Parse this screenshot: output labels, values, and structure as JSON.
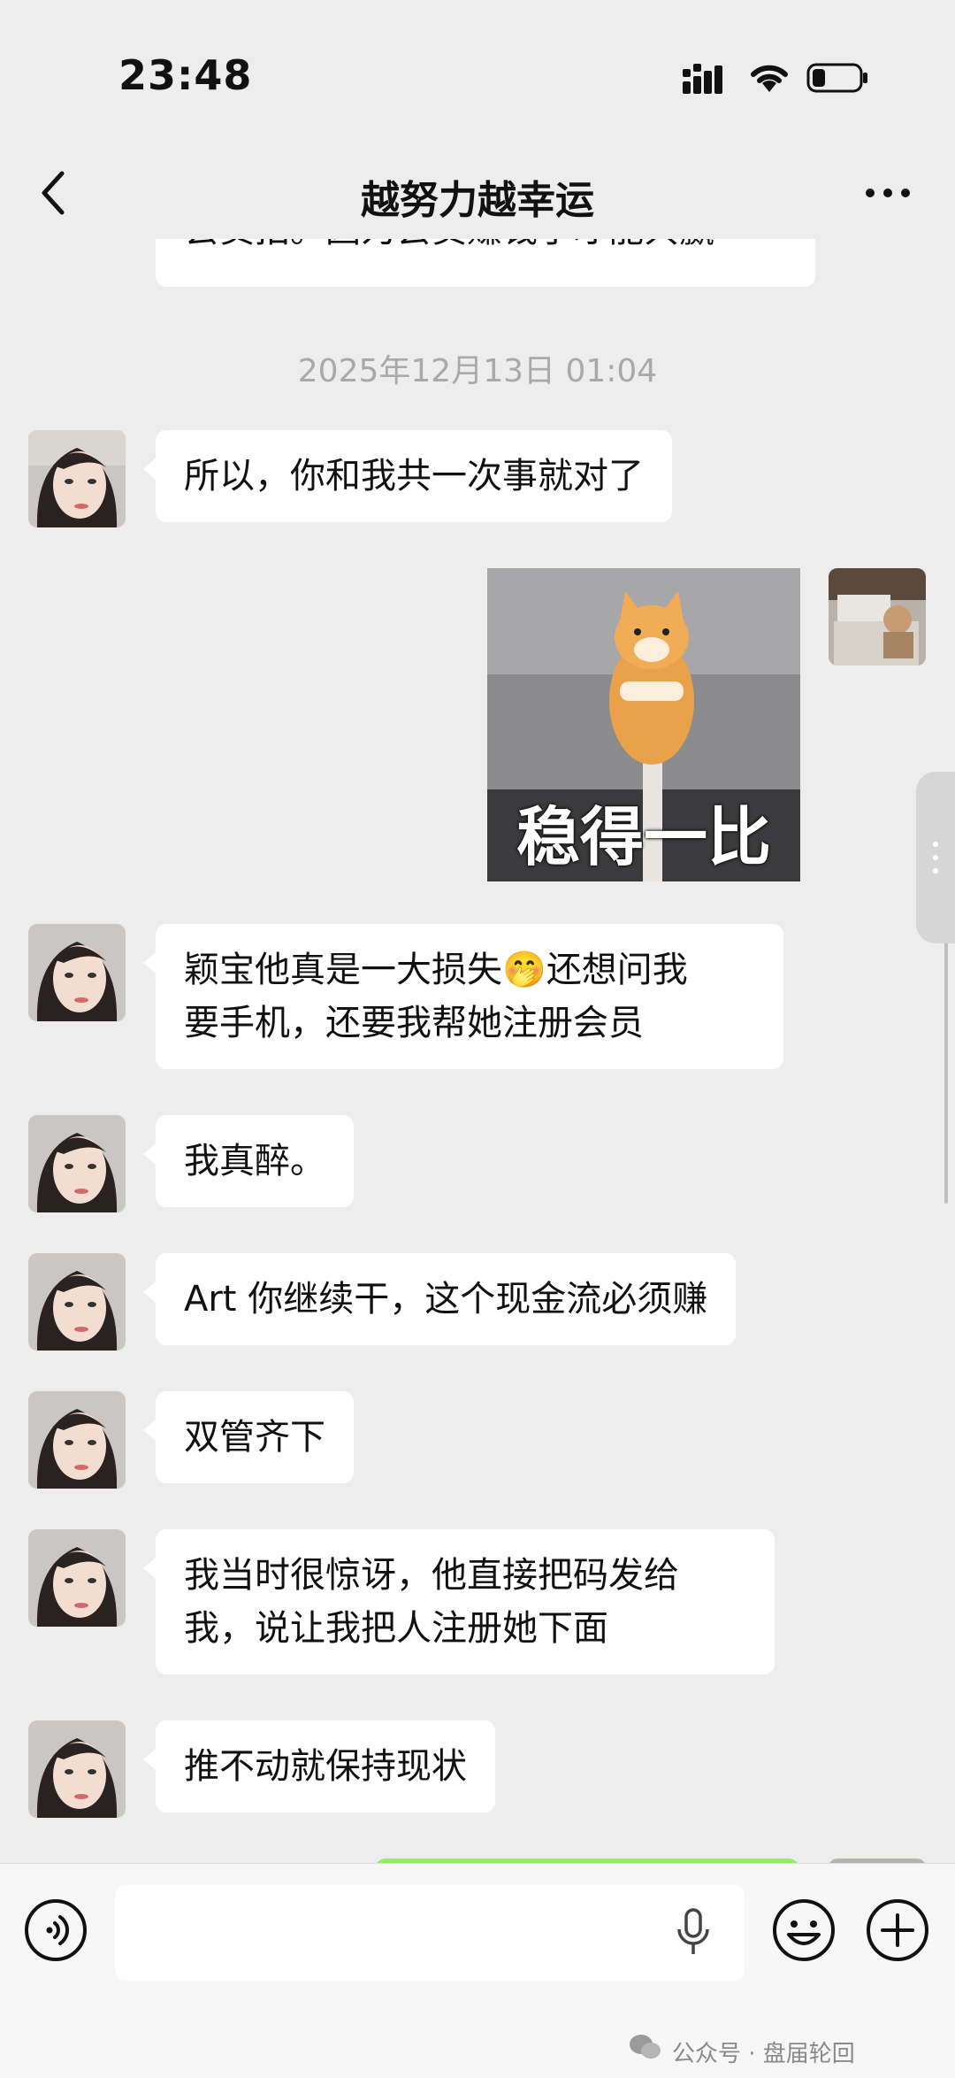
{
  "status_bar": {
    "time": "23:48"
  },
  "nav": {
    "title": "越努力越幸运"
  },
  "chat": {
    "top_partial_text": "会员拍。因为会员赚钱了才能共赢",
    "timestamp": "2025年12月13日 01:04",
    "messages": [
      {
        "text": "所以，你和我共一次事就对了"
      },
      {
        "sticker_caption": "稳得一比"
      },
      {
        "text_a": "颖宝他真是一大损失",
        "emoji": "🤭",
        "text_b": "还想问我",
        "text_c": "要手机，还要我帮她注册会员"
      },
      {
        "text": "我真醉。"
      },
      {
        "text": "Art 你继续干，这个现金流必须赚"
      },
      {
        "text": "双管齐下"
      },
      {
        "line1": "我当时很惊讶，他直接把码发给",
        "line2": "我，说让我把人注册她下面"
      },
      {
        "text": "推不动就保持现状"
      }
    ]
  },
  "watermark": "公众号 · 盘届轮回",
  "colors": {
    "background": "#ededed",
    "bubble": "#ffffff",
    "input_bar": "#f7f7f7"
  }
}
